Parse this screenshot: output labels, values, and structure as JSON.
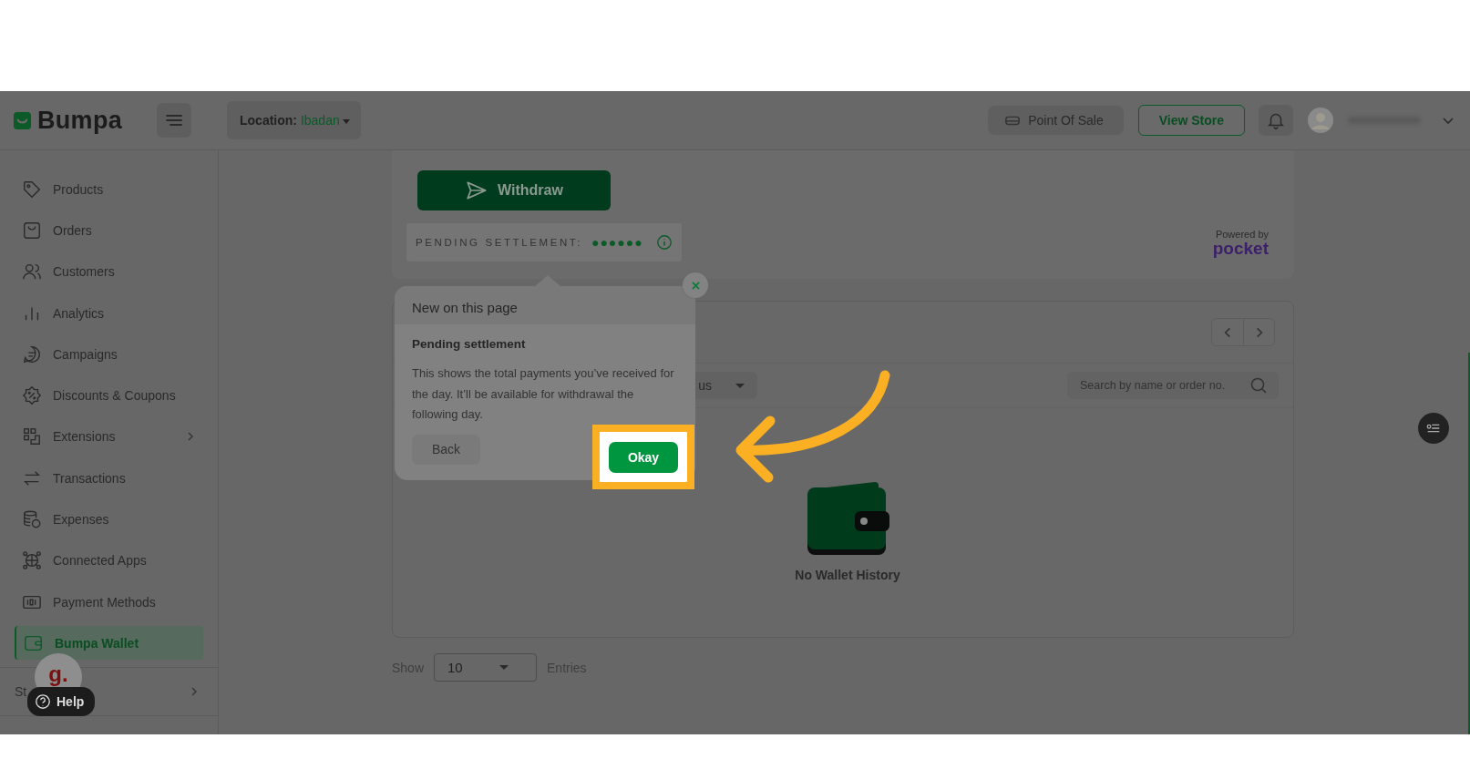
{
  "app": {
    "brand": "Bumpa"
  },
  "header": {
    "location_label": "Location:",
    "location_value": "Ibadan",
    "pos_button": "Point Of Sale",
    "store_button": "View Store"
  },
  "sidebar": {
    "items": [
      {
        "label": "Products",
        "selected": false,
        "expandable": false
      },
      {
        "label": "Orders",
        "selected": false,
        "expandable": false
      },
      {
        "label": "Customers",
        "selected": false,
        "expandable": false
      },
      {
        "label": "Analytics",
        "selected": false,
        "expandable": false
      },
      {
        "label": "Campaigns",
        "selected": false,
        "expandable": false
      },
      {
        "label": "Discounts & Coupons",
        "selected": false,
        "expandable": false
      },
      {
        "label": "Extensions",
        "selected": false,
        "expandable": true
      },
      {
        "label": "Transactions",
        "selected": false,
        "expandable": false
      },
      {
        "label": "Expenses",
        "selected": false,
        "expandable": false
      },
      {
        "label": "Connected Apps",
        "selected": false,
        "expandable": false
      },
      {
        "label": "Payment Methods",
        "selected": false,
        "expandable": false
      },
      {
        "label": "Bumpa Wallet",
        "selected": true,
        "expandable": false
      }
    ],
    "footer_item": "St"
  },
  "wallet": {
    "withdraw_button": "Withdraw",
    "pending_label": "PENDING SETTLEMENT:",
    "pending_masked": "●●●●●●",
    "powered_by": "Powered by",
    "provider": "pocket"
  },
  "history": {
    "status_filter": "us",
    "search_placeholder": "Search by name or order no.",
    "empty_text": "No Wallet History",
    "show_label": "Show",
    "page_size": "10",
    "entries_label": "Entries"
  },
  "tour": {
    "header": "New on this page",
    "title": "Pending settlement",
    "body": "This shows the total payments you’ve received for the day. It’ll be available for withdrawal the following day.",
    "back_button": "Back",
    "okay_button": "Okay"
  },
  "help": {
    "label": "Help",
    "avatar_letter": "g."
  }
}
